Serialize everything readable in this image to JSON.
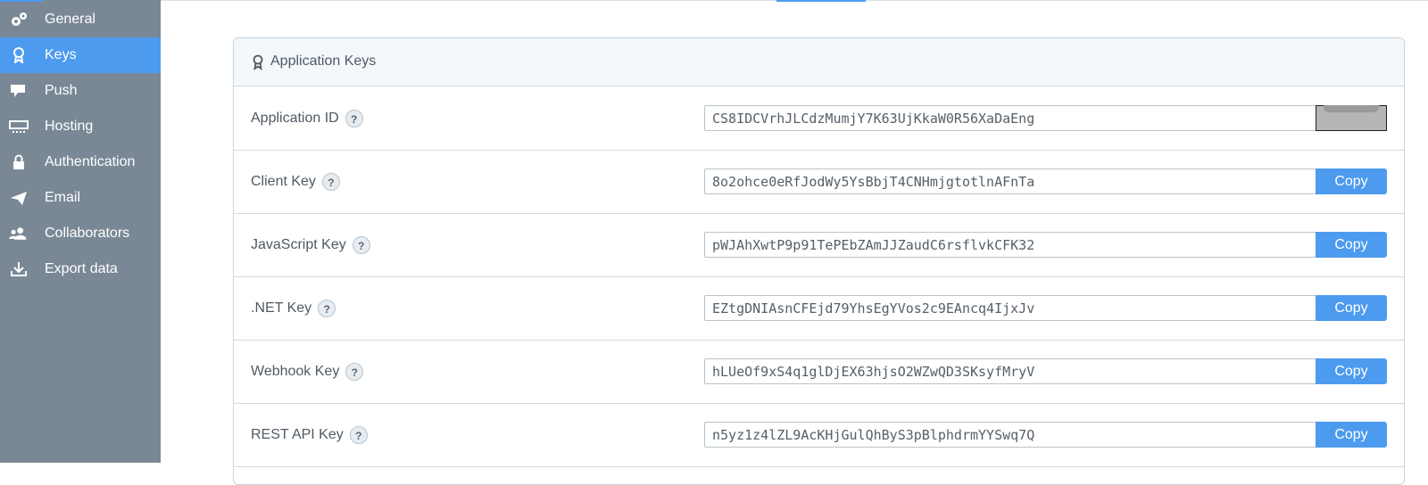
{
  "sidebar": {
    "items": [
      {
        "label": "General",
        "icon": "gears-icon"
      },
      {
        "label": "Keys",
        "icon": "key-icon",
        "active": true
      },
      {
        "label": "Push",
        "icon": "chat-bubble-icon"
      },
      {
        "label": "Hosting",
        "icon": "server-icon"
      },
      {
        "label": "Authentication",
        "icon": "lock-icon"
      },
      {
        "label": "Email",
        "icon": "paper-plane-icon"
      },
      {
        "label": "Collaborators",
        "icon": "users-icon"
      },
      {
        "label": "Export data",
        "icon": "download-icon"
      }
    ]
  },
  "panel": {
    "title": "Application Keys",
    "icon": "key-icon",
    "help_glyph": "?",
    "copy_label": "Copy",
    "rows": [
      {
        "label": "Application ID",
        "value": "CS8IDCVrhJLCdzMumjY7K63UjKkaW0R56XaDaEng",
        "button_state": "pressed"
      },
      {
        "label": "Client Key",
        "value": "8o2ohce0eRfJodWy5YsBbjT4CNHmjgtotlnAFnTa",
        "button_state": "normal"
      },
      {
        "label": "JavaScript Key",
        "value": "pWJAhXwtP9p91TePEbZAmJJZaudC6rsflvkCFK32",
        "button_state": "normal"
      },
      {
        "label": ".NET Key",
        "value": "EZtgDNIAsnCFEjd79YhsEgYVos2c9EAncq4IjxJv",
        "button_state": "normal"
      },
      {
        "label": "Webhook Key",
        "value": "hLUeOf9xS4q1glDjEX63hjsO2WZwQD3SKsyfMryV",
        "button_state": "normal"
      },
      {
        "label": "REST API Key",
        "value": "n5yz1z4lZL9AcKHjGulQhByS3pBlphdrmYYSwq7Q",
        "button_state": "normal"
      }
    ]
  },
  "colors": {
    "sidebar_bg": "#7a8896",
    "accent": "#4d9bef",
    "panel_header_bg": "#f4f8fb",
    "text": "#4f5a65"
  }
}
